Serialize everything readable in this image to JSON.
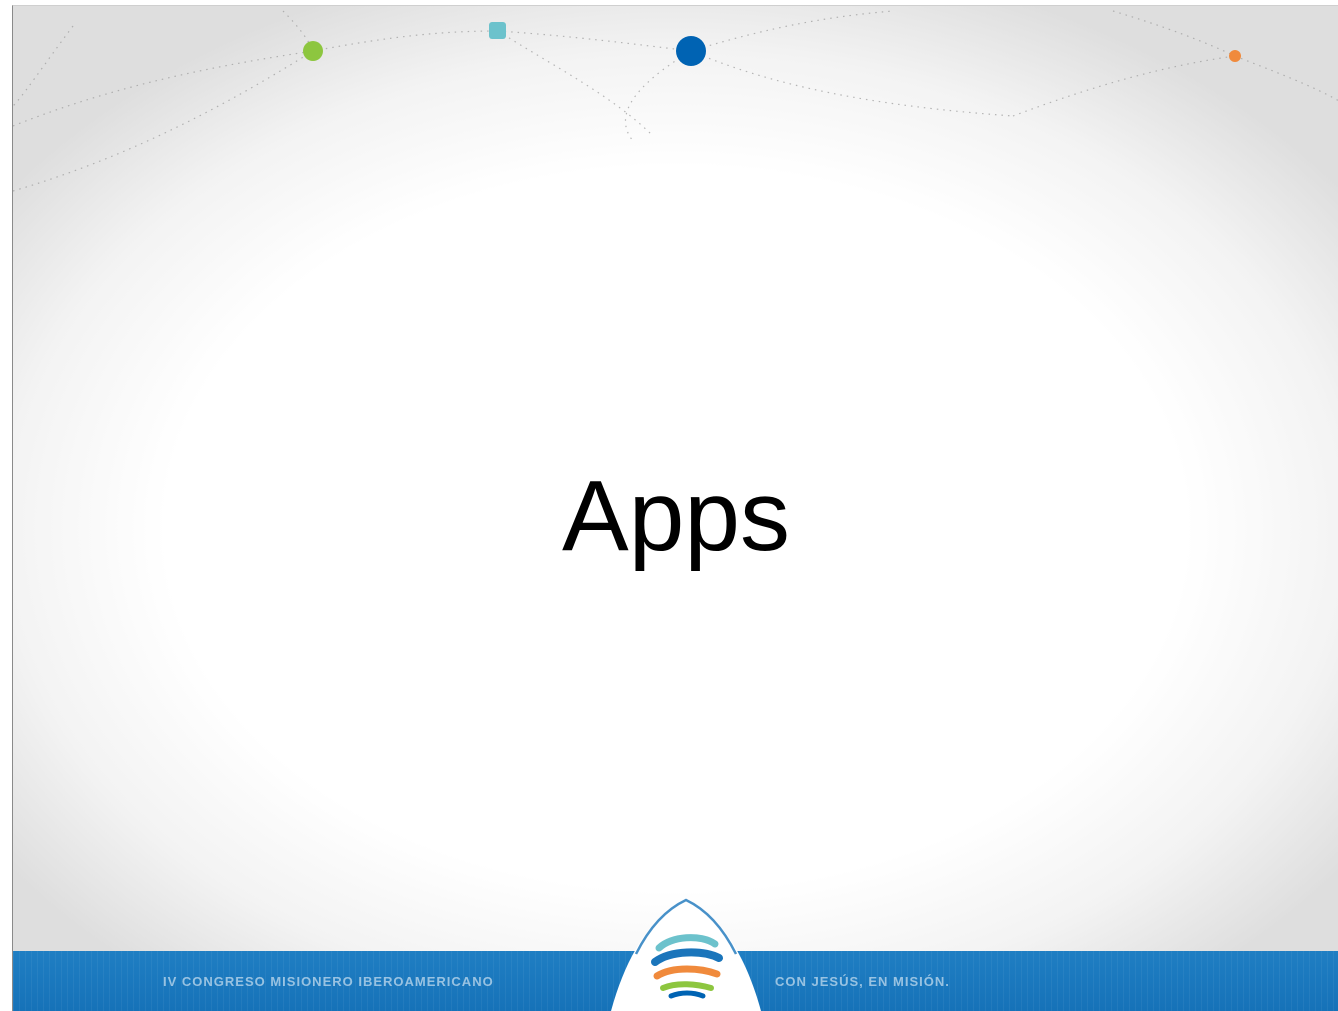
{
  "slide": {
    "title": "Apps",
    "footer_left": "IV CONGRESO MISIONERO IBEROAMERICANO",
    "footer_right": "CON JESÚS, EN MISIÓN."
  },
  "colors": {
    "band_blue": "#1a75bb",
    "dot_green": "#8dc63f",
    "dot_teal": "#6cc2cc",
    "dot_blue": "#0063b3",
    "dot_orange": "#f08a3c",
    "title_text": "#000000"
  },
  "icons": {
    "logo": "globe-ribbon-logo"
  }
}
